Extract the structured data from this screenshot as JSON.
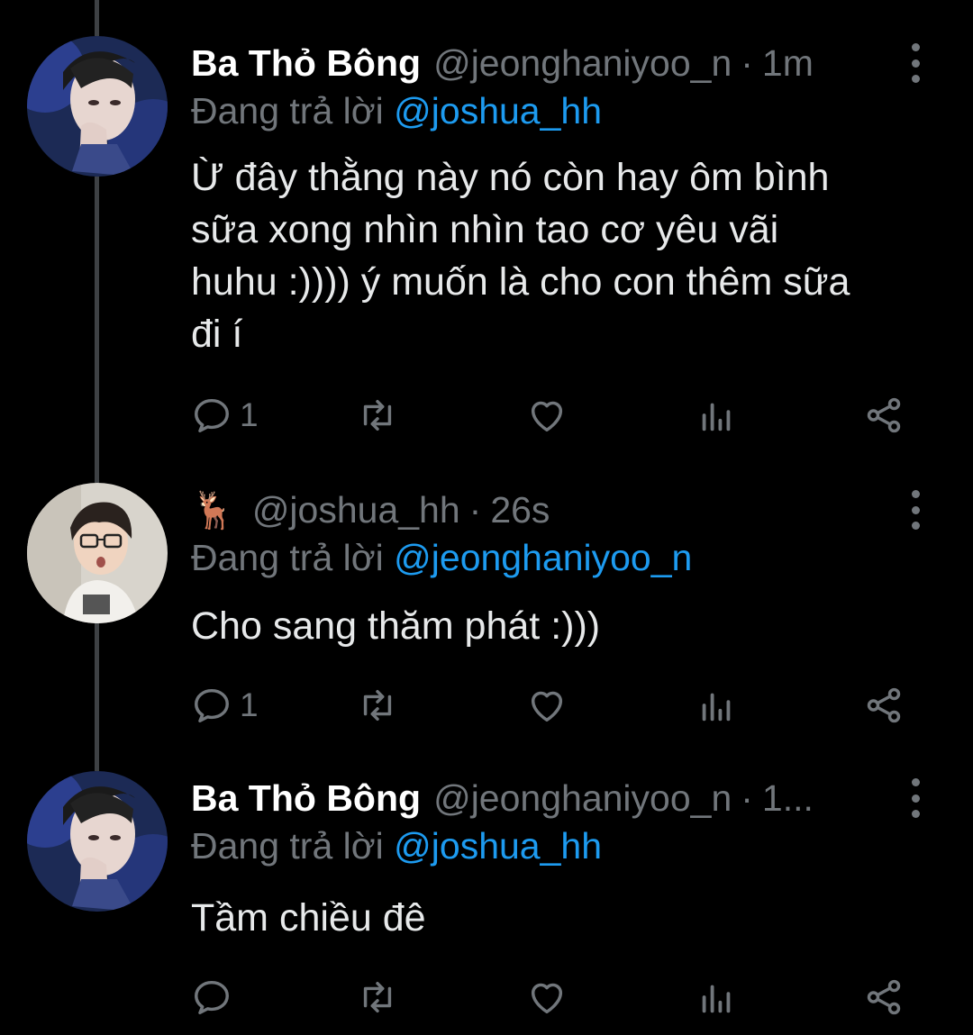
{
  "tweets": [
    {
      "display_name": "Ba Thỏ Bông",
      "handle": "@jeonghaniyoo_n",
      "dot": "·",
      "time": "1m",
      "replying_prefix": "Đang trả lời",
      "replying_to": "@joshua_hh",
      "lines": [
        "Ừ đây thằng này nó còn hay ôm bình",
        "sữa xong nhìn nhìn tao cơ yêu vãi",
        "huhu :)))) ý muốn là cho con thêm sữa",
        "đi í"
      ],
      "reply_count": "1"
    },
    {
      "display_name_icon": "deer-emoji",
      "display_name_emoji": "🦌",
      "handle": "@joshua_hh",
      "dot": "·",
      "time": "26s",
      "replying_prefix": "Đang trả lời",
      "replying_to": "@jeonghaniyoo_n",
      "lines": [
        "Cho sang thăm phát :)))"
      ],
      "reply_count": "1"
    },
    {
      "display_name": "Ba Thỏ Bông",
      "handle": "@jeonghaniyoo_n",
      "dot": "·",
      "time": "1...",
      "replying_prefix": "Đang trả lời",
      "replying_to": "@joshua_hh",
      "lines": [
        "Tầm chiều đê"
      ],
      "reply_count": ""
    }
  ],
  "icons": {
    "reply": "reply-icon",
    "retweet": "retweet-icon",
    "like": "heart-icon",
    "views": "analytics-icon",
    "share": "share-icon",
    "more": "more-options-icon"
  },
  "colors": {
    "background": "#000000",
    "text": "#e7e9ea",
    "muted": "#71767b",
    "accent": "#1d9bf0",
    "thread_line": "#3e4144"
  }
}
